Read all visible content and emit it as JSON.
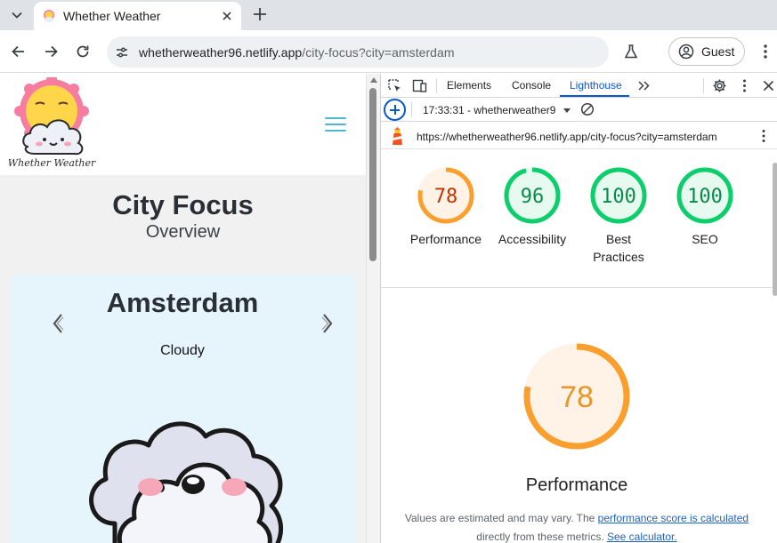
{
  "browser": {
    "tab_title": "Whether Weather",
    "url_host": "whetherweather96.netlify.app",
    "url_path": "/city-focus?city=amsterdam",
    "profile_label": "Guest"
  },
  "page": {
    "title": "City Focus",
    "subtitle": "Overview",
    "logo_text": "Whether Weather",
    "city": {
      "name": "Amsterdam",
      "condition": "Cloudy"
    }
  },
  "devtools": {
    "tabs": [
      "Elements",
      "Console",
      "Lighthouse"
    ],
    "active_tab": "Lighthouse",
    "report_label": "17:33:31 - whetherweather9",
    "report_url": "https://whetherweather96.netlify.app/city-focus?city=amsterdam",
    "scores": [
      {
        "label": "Performance",
        "value": 78,
        "color": "#fa9f2d",
        "bg": "#fef3e6",
        "text_color": "#c33300"
      },
      {
        "label": "Accessibility",
        "value": 96,
        "color": "#0cce6b",
        "bg": "#e6faf0",
        "text_color": "#0a8a4a"
      },
      {
        "label": "Best Practices",
        "value": 100,
        "color": "#0cce6b",
        "bg": "#e6faf0",
        "text_color": "#0a8a4a"
      },
      {
        "label": "SEO",
        "value": 100,
        "color": "#0cce6b",
        "bg": "#e6faf0",
        "text_color": "#0a8a4a"
      }
    ],
    "detail": {
      "score": 78,
      "label": "Performance",
      "note_prefix": "Values are estimated and may vary. The ",
      "note_link1": "performance score is calculated",
      "note_middle": " directly from these metrics. ",
      "note_link2": "See calculator."
    }
  }
}
